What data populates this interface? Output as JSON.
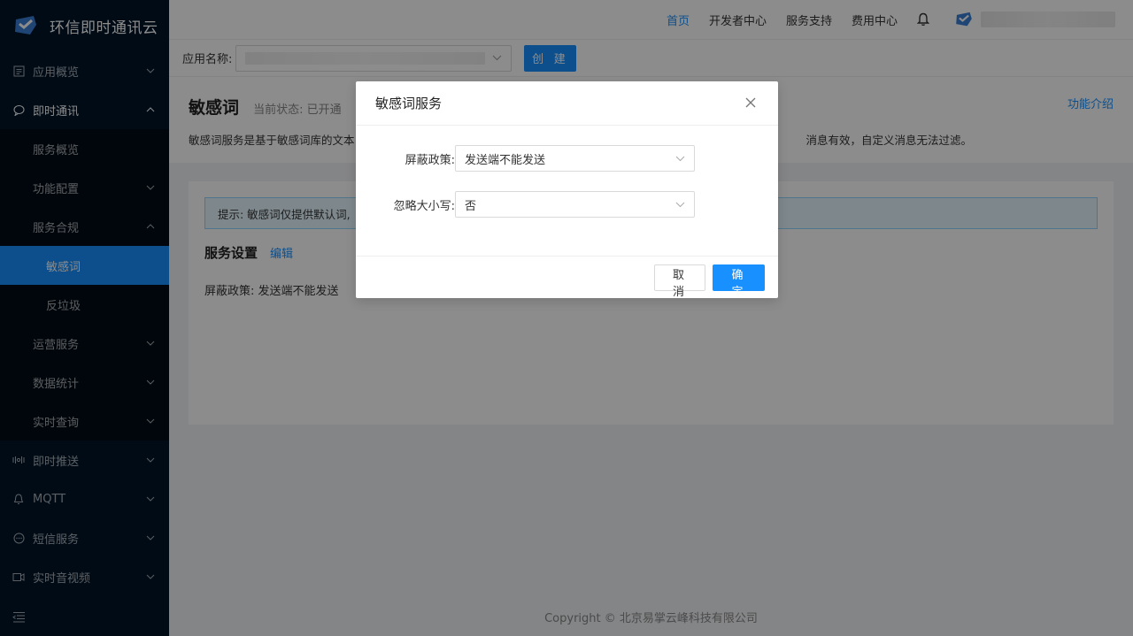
{
  "brand": {
    "name": "环信即时通讯云"
  },
  "sidebar": {
    "items": [
      {
        "label": "应用概览",
        "icon": "file-icon"
      },
      {
        "label": "即时通讯",
        "icon": "chat-icon"
      },
      {
        "label": "服务概览"
      },
      {
        "label": "功能配置"
      },
      {
        "label": "服务合规"
      },
      {
        "label": "敏感词"
      },
      {
        "label": "反垃圾"
      },
      {
        "label": "运营服务"
      },
      {
        "label": "数据统计"
      },
      {
        "label": "实时查询"
      },
      {
        "label": "即时推送",
        "icon": "push-icon"
      },
      {
        "label": "MQTT",
        "icon": "mqtt-icon"
      },
      {
        "label": "短信服务",
        "icon": "sms-icon"
      },
      {
        "label": "实时音视频",
        "icon": "video-icon"
      }
    ]
  },
  "topnav": {
    "home": "首页",
    "developer": "开发者中心",
    "support": "服务支持",
    "billing": "费用中心"
  },
  "appbar": {
    "label": "应用名称:",
    "create": "创 建"
  },
  "page": {
    "title": "敏感词",
    "status": "当前状态: 已开通",
    "intro_link": "功能介绍",
    "desc_left": "敏感词服务是基于敏感词库的文本",
    "desc_right": "消息有效，自定义消息无法过滤。"
  },
  "content": {
    "tip": "提示: 敏感词仅提供默认词,",
    "service_settings": "服务设置",
    "edit": "编辑",
    "policy_line": "屏蔽政策: 发送端不能发送"
  },
  "modal": {
    "title": "敏感词服务",
    "fields": [
      {
        "label": "屏蔽政策:",
        "value": "发送端不能发送"
      },
      {
        "label": "忽略大小写:",
        "value": "否"
      }
    ],
    "cancel": "取 消",
    "ok": "确 定"
  },
  "footer": {
    "copyright": "Copyright © 北京易掌云峰科技有限公司"
  },
  "colors": {
    "primary": "#1890ff",
    "sidebar": "#001529"
  }
}
